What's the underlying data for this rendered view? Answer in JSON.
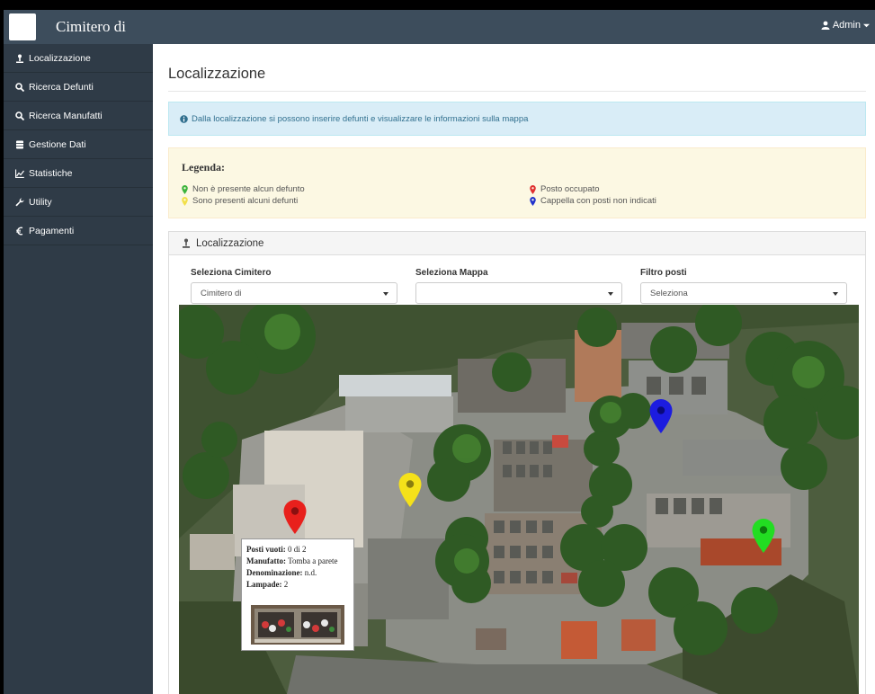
{
  "header": {
    "brand": "Cimitero di",
    "user_label": "Admin",
    "icons": {
      "user": "user-icon",
      "caret": "caret-down-icon"
    }
  },
  "sidebar": {
    "items": [
      {
        "label": "Localizzazione",
        "icon": "map-marker-icon"
      },
      {
        "label": "Ricerca Defunti",
        "icon": "search-icon"
      },
      {
        "label": "Ricerca Manufatti",
        "icon": "search-icon"
      },
      {
        "label": "Gestione Dati",
        "icon": "database-icon"
      },
      {
        "label": "Statistiche",
        "icon": "line-chart-icon"
      },
      {
        "label": "Utility",
        "icon": "wrench-icon"
      },
      {
        "label": "Pagamenti",
        "icon": "euro-icon"
      }
    ]
  },
  "main": {
    "title": "Localizzazione",
    "info_text": "Dalla localizzazione si possono inserire defunti e visualizzare le informazioni sulla mappa",
    "legend": {
      "title": "Legenda:",
      "items": [
        {
          "label": "Non è presente alcun defunto",
          "color": "#3cb43c"
        },
        {
          "label": "Sono presenti alcuni defunti",
          "color": "#f2e04a"
        },
        {
          "label": "Posto occupato",
          "color": "#e03030"
        },
        {
          "label": "Cappella con posti non indicati",
          "color": "#2233cc"
        }
      ]
    },
    "panel": {
      "title": "Localizzazione",
      "fields": [
        {
          "label": "Seleziona Cimitero",
          "value": "Cimitero di"
        },
        {
          "label": "Seleziona Mappa",
          "value": ""
        },
        {
          "label": "Filtro posti",
          "value": "Seleziona"
        }
      ]
    },
    "map": {
      "markers": [
        {
          "name": "marker-red",
          "color": "#e8201c"
        },
        {
          "name": "marker-yellow",
          "color": "#f5e11a"
        },
        {
          "name": "marker-blue",
          "color": "#1c1ce0"
        },
        {
          "name": "marker-green",
          "color": "#22dd22"
        }
      ],
      "popup": {
        "posti_label": "Posti vuoti:",
        "posti_value": "0 di 2",
        "manufatto_label": "Manufatto:",
        "manufatto_value": "Tomba a parete",
        "denominazione_label": "Denominazione:",
        "denominazione_value": "n.d.",
        "lampade_label": "Lampade:",
        "lampade_value": "2"
      }
    }
  },
  "colors": {
    "topbar": "#3d4d5c",
    "sidebar": "#2f3b47",
    "info_bg": "#d9edf7",
    "legend_bg": "#fcf8e3"
  }
}
